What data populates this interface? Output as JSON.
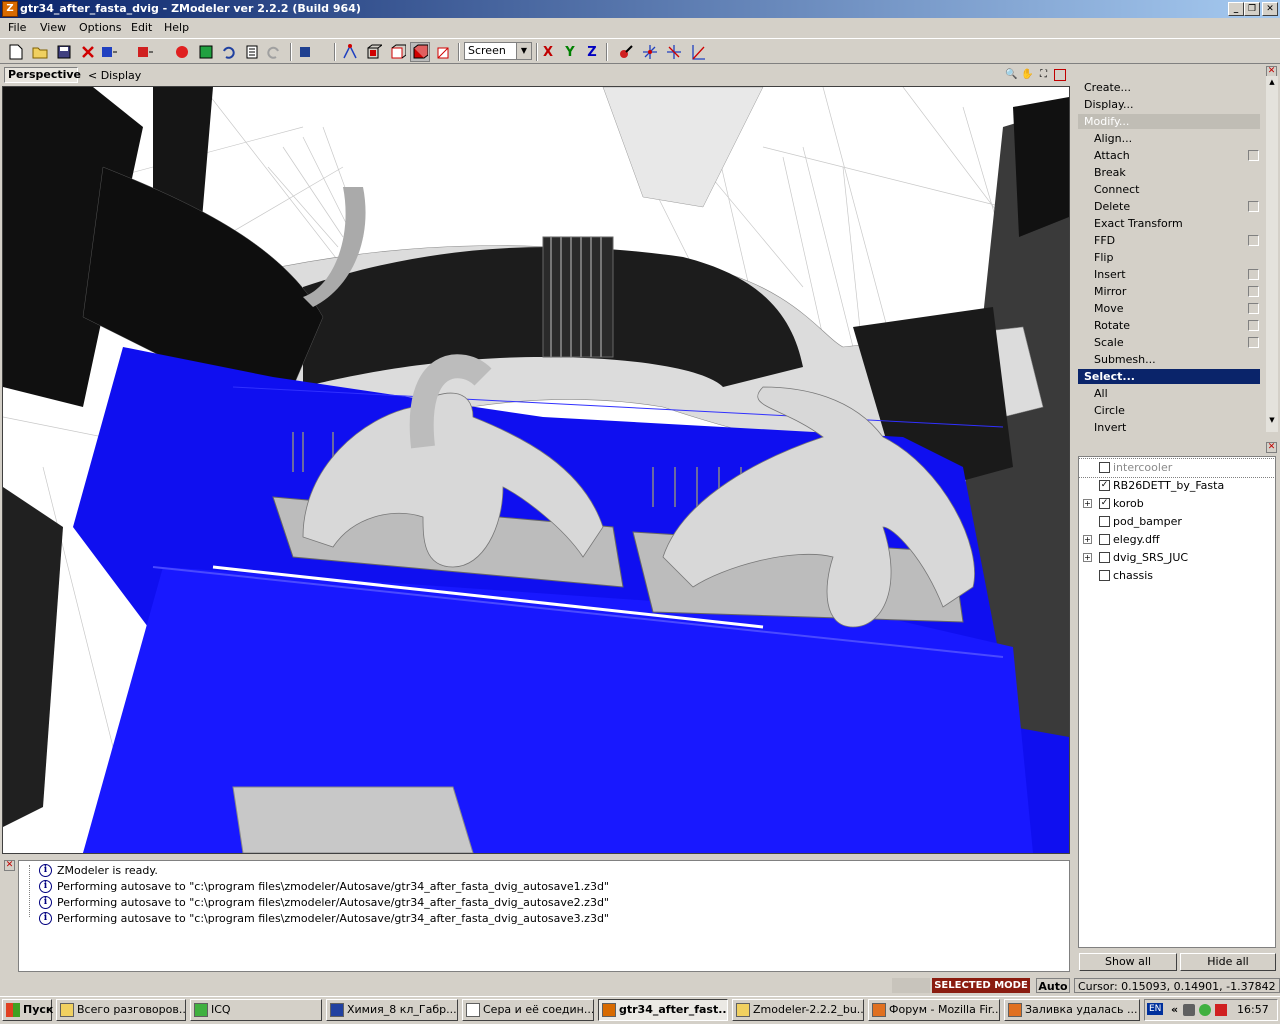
{
  "window": {
    "title": "gtr34_after_fasta_dvig - ZModeler ver 2.2.2 (Build 964)",
    "app_icon": "Z",
    "minimize": "_",
    "restore": "❐",
    "close": "✕"
  },
  "menu": [
    "File",
    "View",
    "Options",
    "Edit",
    "Help"
  ],
  "toolbar": {
    "icons": [
      "new-file-icon",
      "open-folder-icon",
      "save-icon",
      "delete-icon",
      "import-icon",
      "export-icon",
      "record-icon",
      "image-icon",
      "undo-icon",
      "notes-icon",
      "redo-icon",
      "material-icon",
      "select-vertex-icon",
      "select-face-icon",
      "select-object-icon",
      "select-solid-icon",
      "select-wire-icon",
      "tool-cube-icon"
    ],
    "screen_mode": "Screen",
    "axis_x": "X",
    "axis_y": "Y",
    "axis_z": "Z",
    "axis_colors": {
      "x": "#c00000",
      "y": "#008000",
      "z": "#0000c0"
    }
  },
  "viewport": {
    "name": "Perspective",
    "display_link": "< Display"
  },
  "commands": {
    "items": [
      {
        "label": "Create...",
        "sub": false,
        "checkbox": false
      },
      {
        "label": "Display...",
        "sub": false,
        "checkbox": false
      },
      {
        "label": "Modify...",
        "sub": false,
        "checkbox": false,
        "state": "disabled"
      },
      {
        "label": "Align...",
        "sub": true,
        "checkbox": false
      },
      {
        "label": "Attach",
        "sub": true,
        "checkbox": true
      },
      {
        "label": "Break",
        "sub": true,
        "checkbox": false
      },
      {
        "label": "Connect",
        "sub": true,
        "checkbox": false
      },
      {
        "label": "Delete",
        "sub": true,
        "checkbox": true
      },
      {
        "label": "Exact Transform",
        "sub": true,
        "checkbox": false
      },
      {
        "label": "FFD",
        "sub": true,
        "checkbox": true
      },
      {
        "label": "Flip",
        "sub": true,
        "checkbox": false
      },
      {
        "label": "Insert",
        "sub": true,
        "checkbox": true
      },
      {
        "label": "Mirror",
        "sub": true,
        "checkbox": true
      },
      {
        "label": "Move",
        "sub": true,
        "checkbox": true
      },
      {
        "label": "Rotate",
        "sub": true,
        "checkbox": true
      },
      {
        "label": "Scale",
        "sub": true,
        "checkbox": true
      },
      {
        "label": "Submesh...",
        "sub": true,
        "checkbox": false
      },
      {
        "label": "Select...",
        "sub": false,
        "checkbox": false,
        "state": "selected"
      },
      {
        "label": "All",
        "sub": true,
        "checkbox": false
      },
      {
        "label": "Circle",
        "sub": true,
        "checkbox": false
      },
      {
        "label": "Invert",
        "sub": true,
        "checkbox": false
      }
    ]
  },
  "objects": {
    "items": [
      {
        "label": "intercooler",
        "expand": false,
        "checked": false,
        "dim": true
      },
      {
        "label": "RB26DETT_by_Fasta",
        "expand": false,
        "checked": true,
        "dim": false
      },
      {
        "label": "korob",
        "expand": true,
        "checked": true,
        "dim": false
      },
      {
        "label": "pod_bamper",
        "expand": false,
        "checked": false,
        "dim": false
      },
      {
        "label": "elegy.dff",
        "expand": true,
        "checked": false,
        "dim": false
      },
      {
        "label": "dvig_SRS_JUC",
        "expand": true,
        "checked": false,
        "dim": false
      },
      {
        "label": "chassis",
        "expand": false,
        "checked": false,
        "dim": false
      }
    ],
    "show_all": "Show all",
    "hide_all": "Hide all"
  },
  "log": [
    "ZModeler is ready.",
    "Performing autosave to \"c:\\program files\\zmodeler/Autosave/gtr34_after_fasta_dvig_autosave1.z3d\"",
    "Performing autosave to \"c:\\program files\\zmodeler/Autosave/gtr34_after_fasta_dvig_autosave2.z3d\"",
    "Performing autosave to \"c:\\program files\\zmodeler/Autosave/gtr34_after_fasta_dvig_autosave3.z3d\""
  ],
  "status": {
    "mode": "SELECTED MODE",
    "auto": "Auto",
    "cursor": "Cursor: 0.15093, 0.14901, -1.37842"
  },
  "taskbar": {
    "start": "Пуск",
    "tasks": [
      {
        "label": "Всего разговоров...",
        "icon": "folder-icon",
        "active": false
      },
      {
        "label": "ICQ",
        "icon": "icq-icon",
        "active": false
      },
      {
        "label": "Химия_8 кл_Габр...",
        "icon": "winamp-icon",
        "active": false
      },
      {
        "label": "Сера и её соедин...",
        "icon": "document-icon",
        "active": false
      },
      {
        "label": "gtr34_after_fast...",
        "icon": "zmodeler-icon",
        "active": true
      },
      {
        "label": "Zmodeler-2.2.2_bu...",
        "icon": "folder-icon",
        "active": false
      },
      {
        "label": "Форум - Mozilla Fir...",
        "icon": "firefox-icon",
        "active": false
      },
      {
        "label": "Заливка удалась ...",
        "icon": "firefox-icon",
        "active": false
      }
    ],
    "lang": "EN",
    "clock": "16:57"
  }
}
